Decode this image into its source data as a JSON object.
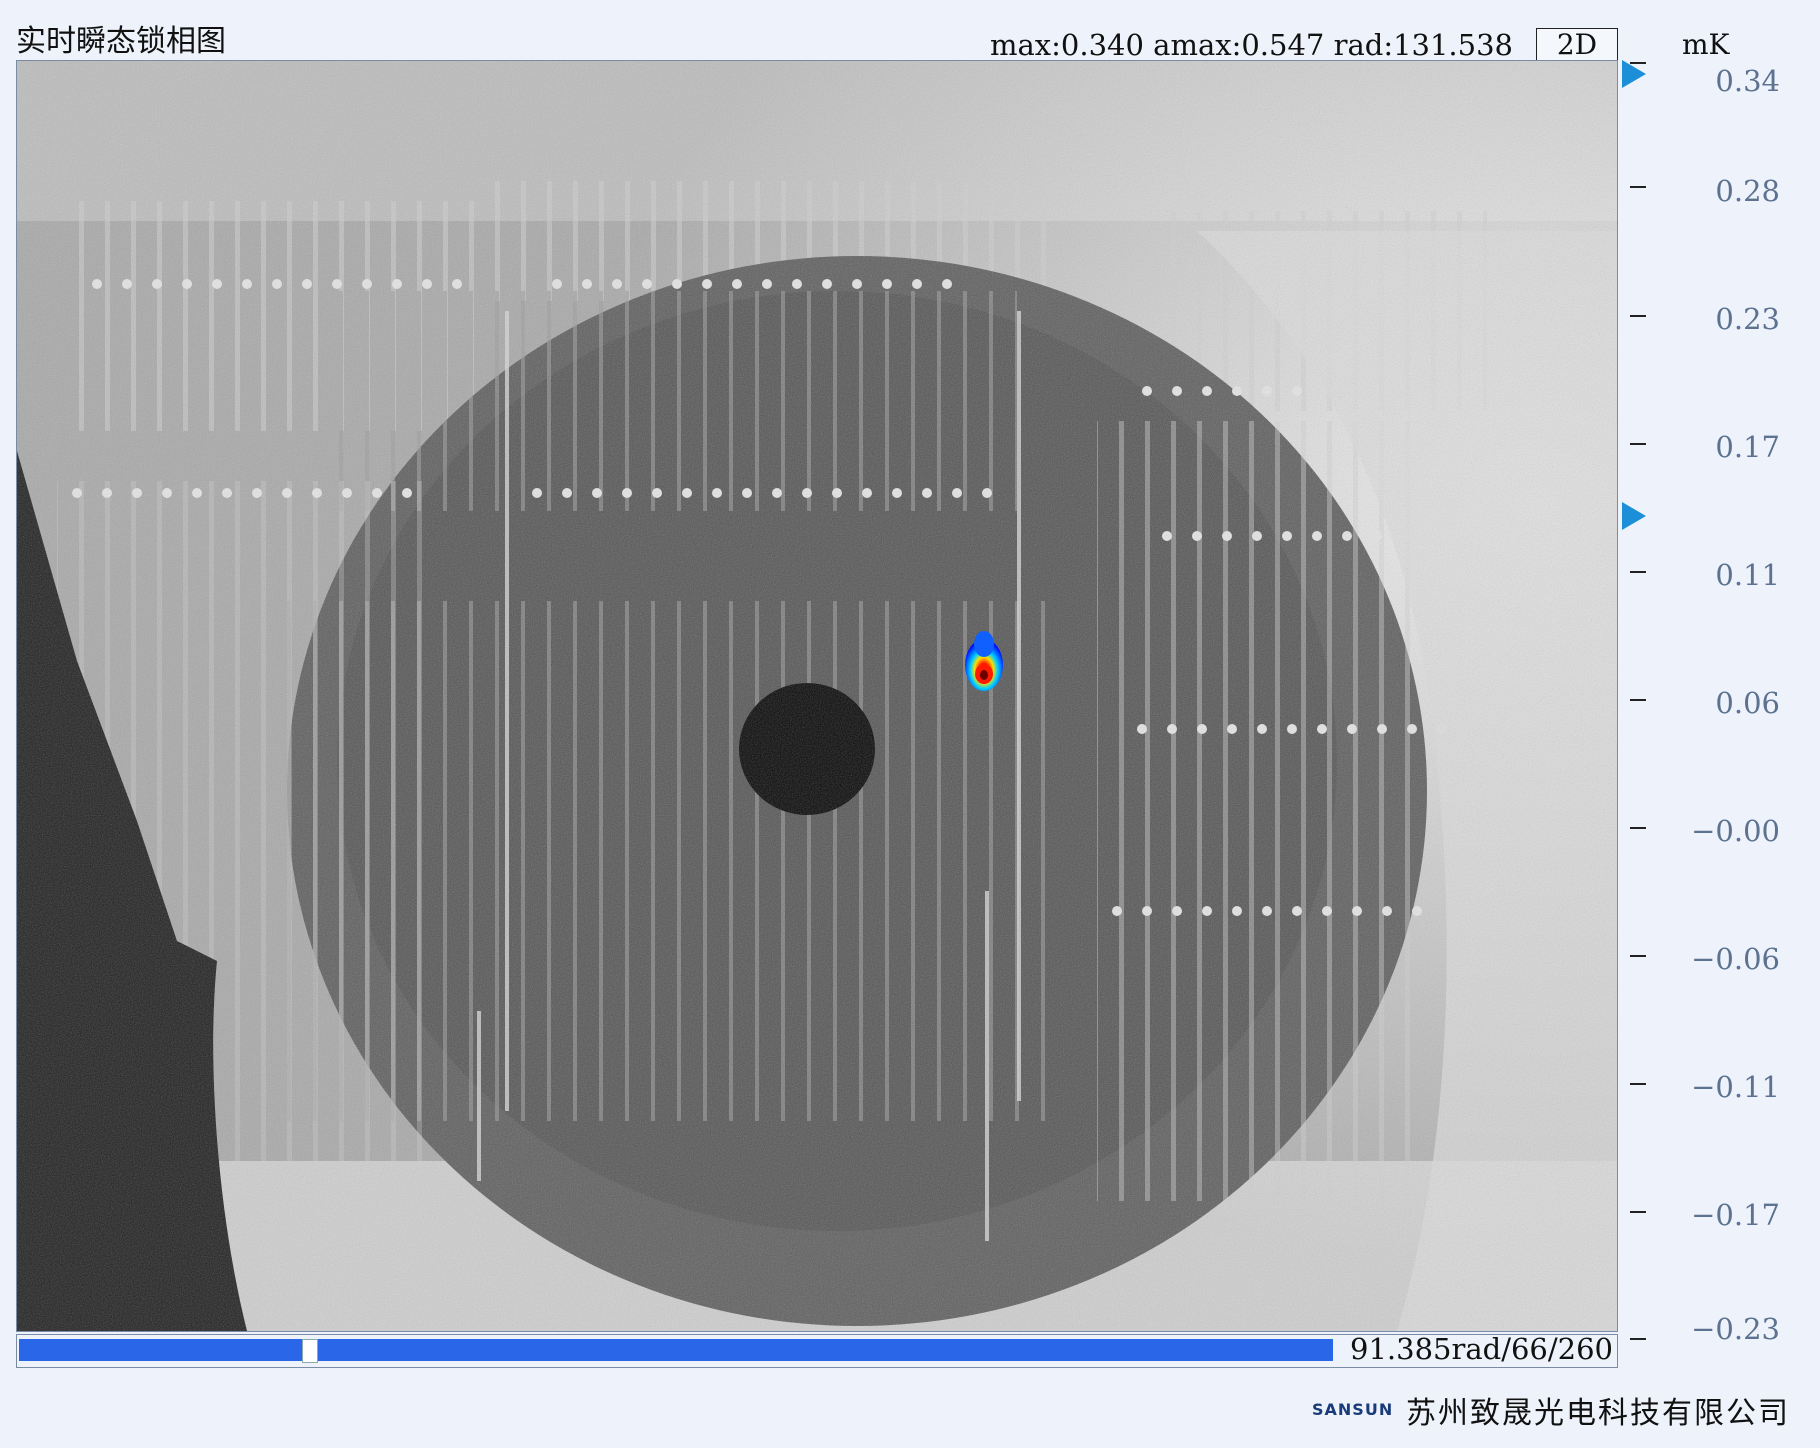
{
  "header": {
    "title": "实时瞬态锁相图",
    "stats": "max:0.340  amax:0.547  rad:131.538",
    "mode_label": "2D",
    "unit": "mK"
  },
  "scale": {
    "ticks": [
      "0.34",
      "0.28",
      "0.23",
      "0.17",
      "0.11",
      "0.06",
      "−0.00",
      "−0.06",
      "−0.11",
      "−0.17",
      "−0.23"
    ]
  },
  "progress": {
    "label": "91.385rad/66/260",
    "value_fraction": 0.2154
  },
  "footer": {
    "brand": "SANSUN",
    "company": "苏州致晟光电科技有限公司"
  },
  "colors": {
    "accent": "#2a66e8",
    "marker": "#1d8fd8",
    "tick_label": "#5d7290",
    "hotspot_core": "#ff0000",
    "hotspot_outer": "#0000ff"
  }
}
